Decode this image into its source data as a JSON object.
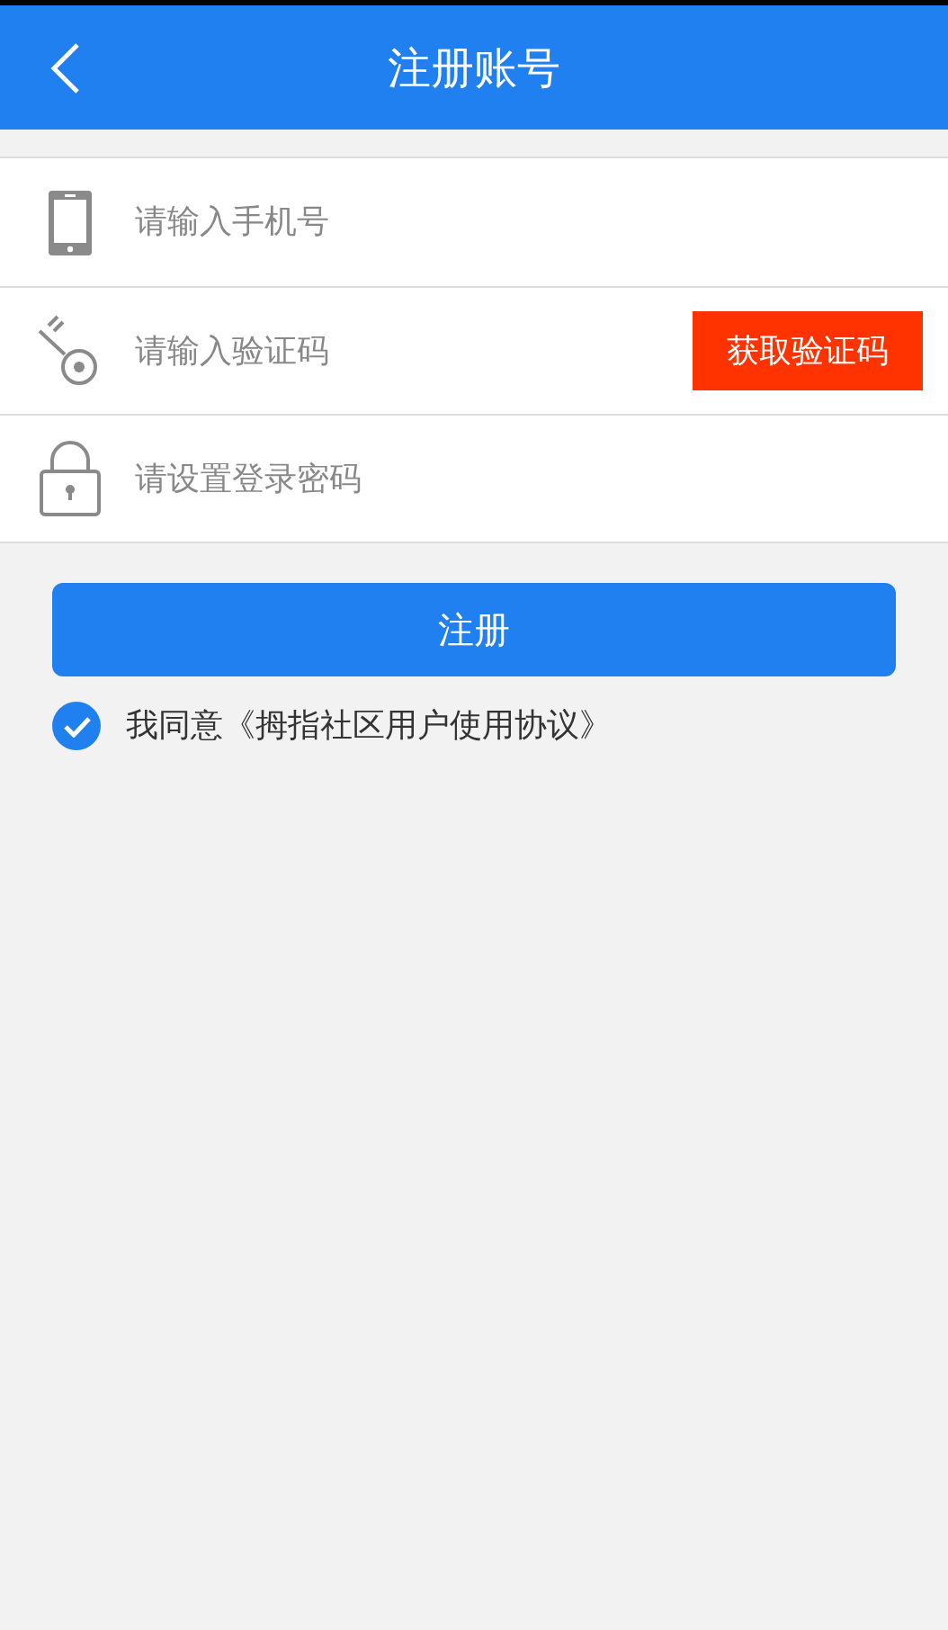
{
  "header": {
    "title": "注册账号"
  },
  "fields": [
    {
      "kind": "phone",
      "placeholder": "请输入手机号"
    },
    {
      "kind": "code",
      "placeholder": "请输入验证码",
      "action": "获取验证码"
    },
    {
      "kind": "password",
      "placeholder": "请设置登录密码"
    }
  ],
  "submit": "注册",
  "agreement": {
    "checked": true,
    "text": "我同意《拇指社区用户使用协议》"
  }
}
